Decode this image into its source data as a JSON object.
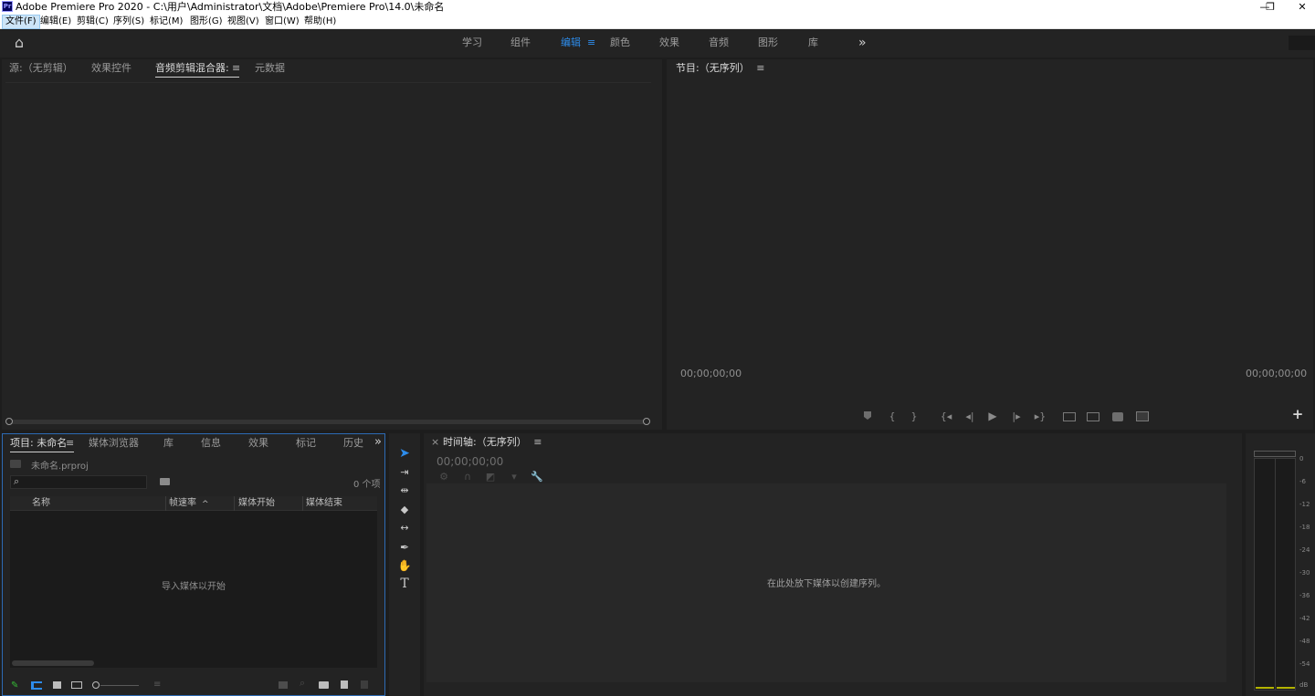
{
  "window": {
    "app_icon": "Pr",
    "title": "Adobe Premiere Pro 2020 - C:\\用户\\Administrator\\文档\\Adobe\\Premiere Pro\\14.0\\未命名",
    "minimize": "—",
    "restore": "❐",
    "close": "✕"
  },
  "menu": [
    "文件(F)",
    "编辑(E)",
    "剪辑(C)",
    "序列(S)",
    "标记(M)",
    "图形(G)",
    "视图(V)",
    "窗口(W)",
    "帮助(H)"
  ],
  "workspaces": {
    "home_icon": "⌂",
    "tabs": [
      "学习",
      "组件",
      "编辑",
      "颜色",
      "效果",
      "音频",
      "图形",
      "库"
    ],
    "active": "编辑",
    "active_menu": "≡",
    "more": "»"
  },
  "source_panel": {
    "tabs": [
      "源:（无剪辑）",
      "效果控件",
      "音频剪辑混合器:",
      "元数据"
    ],
    "active_tab": "音频剪辑混合器:",
    "menu_icon": "≡"
  },
  "program_panel": {
    "title": "节目:（无序列）",
    "menu_icon": "≡",
    "timecode_left": "00;00;00;00",
    "timecode_right": "00;00;00;00",
    "add_icon": "+"
  },
  "project_panel": {
    "tabs": [
      "项目: 未命名",
      "媒体浏览器",
      "库",
      "信息",
      "效果",
      "标记",
      "历史"
    ],
    "active_tab": "项目: 未命名",
    "menu_icon": "≡",
    "more": "»",
    "file_name": "未命名.prproj",
    "search_placeholder": "",
    "item_count": "0 个项",
    "columns": [
      "名称",
      "帧速率",
      "媒体开始",
      "媒体结束"
    ],
    "sort_indicator": "^",
    "empty_text": "导入媒体以开始"
  },
  "tools": [
    "selection-tool",
    "track-select-tool",
    "ripple-edit-tool",
    "razor-tool",
    "slip-tool",
    "pen-tool",
    "hand-tool",
    "type-tool"
  ],
  "timeline_panel": {
    "close": "×",
    "title": "时间轴:（无序列）",
    "menu_icon": "≡",
    "timecode": "00;00;00;00",
    "empty_text": "在此处放下媒体以创建序列。"
  },
  "audio_meter": {
    "scale": [
      "0",
      "-6",
      "-12",
      "-18",
      "-24",
      "-30",
      "-36",
      "-42",
      "-48",
      "-54",
      "dB"
    ]
  },
  "colors": {
    "accent": "#2d8ceb",
    "panel": "#232323",
    "background": "#1d1d1d",
    "focus_border": "#2d6ab4"
  }
}
